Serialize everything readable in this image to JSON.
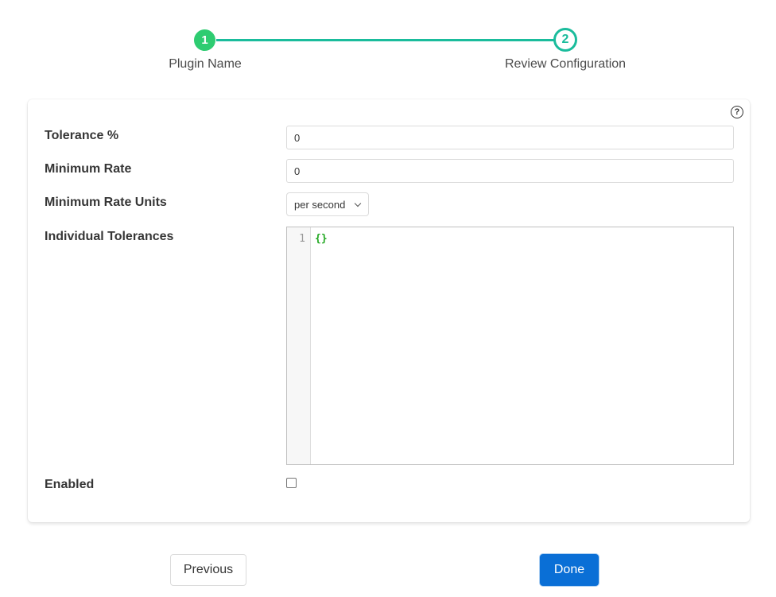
{
  "stepper": {
    "steps": [
      {
        "number": "1",
        "label": "Plugin Name",
        "state": "complete"
      },
      {
        "number": "2",
        "label": "Review Configuration",
        "state": "active"
      }
    ],
    "complete_color": "#2ecc71",
    "active_color": "#1abc9c"
  },
  "form": {
    "help_icon": "?",
    "tolerance": {
      "label": "Tolerance %",
      "value": "0"
    },
    "minimum_rate": {
      "label": "Minimum Rate",
      "value": "0"
    },
    "minimum_rate_units": {
      "label": "Minimum Rate Units",
      "selected": "per second"
    },
    "individual_tolerances": {
      "label": "Individual Tolerances",
      "line_number": "1",
      "code": "{}"
    },
    "enabled": {
      "label": "Enabled",
      "checked": false
    }
  },
  "buttons": {
    "previous": "Previous",
    "done": "Done",
    "primary_color": "#0a6fd6"
  }
}
